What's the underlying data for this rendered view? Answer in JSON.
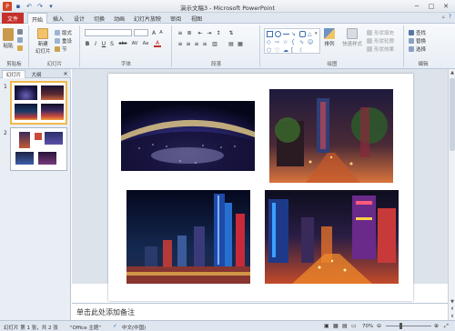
{
  "title_bar": {
    "app_title": "演示文稿3 - Microsoft PowerPoint",
    "minimize": "─",
    "maximize": "□",
    "close": "✕"
  },
  "tabs": {
    "file": "文件",
    "items": [
      "开始",
      "插入",
      "设计",
      "切换",
      "动画",
      "幻灯片放映",
      "审阅",
      "视图"
    ],
    "active": "开始"
  },
  "ribbon": {
    "clipboard": {
      "paste": "粘贴",
      "group": "剪贴板"
    },
    "slides": {
      "new_slide": "新建",
      "new_slide_sub": "幻灯片",
      "layout": "版式",
      "reset": "重设",
      "section": "节",
      "group": "幻灯片"
    },
    "font": {
      "family_value": "",
      "size_value": "",
      "group": "字体",
      "buttons": [
        "B",
        "I",
        "U",
        "S",
        "abc",
        "AV",
        "Aa",
        "A"
      ]
    },
    "paragraph": {
      "group": "段落"
    },
    "drawing": {
      "arrange": "排列",
      "quick_styles": "快速样式",
      "shape_fill": "形状填充",
      "shape_outline": "形状轮廓",
      "shape_effects": "形状效果",
      "group": "绘图"
    },
    "editing": {
      "find": "查找",
      "replace": "替换",
      "select": "选择",
      "group": "编辑"
    }
  },
  "panel": {
    "tab_slides": "幻灯片",
    "tab_outline": "大纲",
    "close": "✕",
    "slide_numbers": [
      "1",
      "2"
    ]
  },
  "notes": {
    "placeholder": "单击此处添加备注"
  },
  "status": {
    "slide_info": "幻灯片 第 1 张，共 2 张",
    "theme": "\"Office 主题\"",
    "language": "中文(中国)",
    "zoom": "70%",
    "zoom_value": 70
  },
  "colors": {
    "file_tab": "#c4302b",
    "selection_border": "#f2b84b",
    "ribbon_bg": "#e8eef5"
  }
}
